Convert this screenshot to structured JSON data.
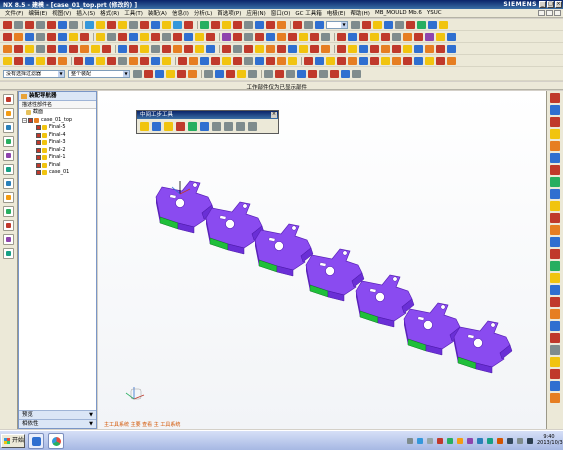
{
  "window": {
    "title": "NX 8.5 - 建模 - [case_01_top.prt (修改的) ]",
    "brand": "SIEMENS"
  },
  "menubar": {
    "items": [
      "文件(F)",
      "编辑(E)",
      "视图(V)",
      "插入(S)",
      "格式(R)",
      "工具(T)",
      "装配(A)",
      "信息(I)",
      "分析(L)",
      "首选项(P)",
      "应用(N)",
      "窗口(O)",
      "GC 工具箱",
      "电极(E)",
      "帮助(H)",
      "MB_MOULD Mb.6",
      "YSUC"
    ]
  },
  "selection_bar": {
    "filter_value": "没有选择过滤器",
    "assembly_scope": "整个装配"
  },
  "status": {
    "message": "工作部件仅为已显示部件"
  },
  "navigator": {
    "title": "装配导航器",
    "column_header": "描述性部件名",
    "rows": [
      {
        "label": "截面",
        "level": 1,
        "kind": "folder"
      },
      {
        "label": "case_01_top",
        "level": 1,
        "kind": "assembly"
      },
      {
        "label": "Final-5",
        "level": 2,
        "kind": "part"
      },
      {
        "label": "Final-4",
        "level": 2,
        "kind": "part"
      },
      {
        "label": "Final-3",
        "level": 2,
        "kind": "part"
      },
      {
        "label": "Final-2",
        "level": 2,
        "kind": "part"
      },
      {
        "label": "Final-1",
        "level": 2,
        "kind": "part"
      },
      {
        "label": "Final",
        "level": 2,
        "kind": "part"
      },
      {
        "label": "case_01",
        "level": 2,
        "kind": "part"
      }
    ],
    "bottom": {
      "preview": "预览",
      "dependency": "相依性"
    }
  },
  "float_toolbar": {
    "title": "中间工步工具"
  },
  "prompt": {
    "text": "主工具系统   主要 查看  主 工具系统"
  },
  "taskbar": {
    "start": "开始",
    "time": "9:40",
    "date": "2013/10/30"
  },
  "colors": {
    "part": "#8a4bf0",
    "part_edge": "#5a22b8",
    "highlight": "#1fbf3a",
    "title_bar": "#0a246a"
  }
}
